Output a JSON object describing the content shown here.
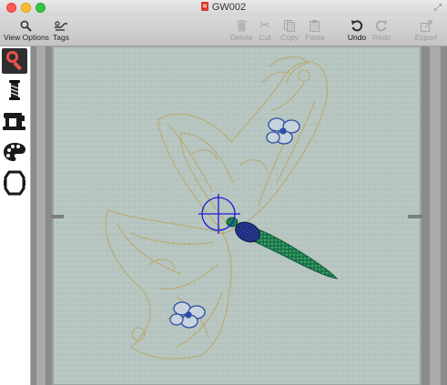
{
  "window": {
    "title": "GW002"
  },
  "toolbar": {
    "view_options": "View Options",
    "tags": "Tags",
    "delete": "Delete",
    "cut": "Cut",
    "copy": "Copy",
    "paste": "Paste",
    "undo": "Undo",
    "redo": "Redo",
    "export": "Export"
  },
  "palette": {
    "items": [
      "magnify-tool-icon",
      "thread-spool-icon",
      "sewing-machine-icon",
      "color-palette-icon",
      "hoop-icon"
    ],
    "active": "magnify-tool-icon"
  },
  "colors": {
    "fabric": "#b8c6c2",
    "hoop_frame": "#8d8f8f",
    "gold_thread": "#b7a35a",
    "blue_thread": "#2c4fa6",
    "green_body": "#1f7d4d",
    "navy_head": "#1d2c7a",
    "crosshair": "#1b1bd6",
    "palette_active": "#e8524d"
  }
}
